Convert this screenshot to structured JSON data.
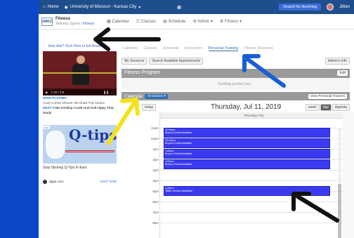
{
  "topnav": {
    "home": "Home",
    "campus": "University of Missouri - Kansas City",
    "search": "Search for Anything",
    "user": "Jillian"
  },
  "app": {
    "logo": "UMKC",
    "title": "Fitness",
    "breadcrumb_root": "Swinney Sports /",
    "breadcrumb_current": "Fitness"
  },
  "mainnav": [
    "Calendar",
    "Classes",
    "Schedule",
    "Admin",
    "Fitness"
  ],
  "left": {
    "ad_link": "View Ads? Click Here to EA Rewards",
    "now_playing_label": "NOW PLAYING",
    "now_playing_title": "Andy Cohen Shows His Road Trip Advice",
    "next_label": "NEXT",
    "next_title": "Fake Dreiling Could Hurl Hull Hippy Trep' Study",
    "ad_tag": "Ad",
    "ad_brand": "Q-tips",
    "ad_caption": "Stop Sticking Q-Tips In Ears",
    "ad_site": "qtips.com",
    "ad_visit": "VISIT SITE",
    "video_time": "1:20 / 2:5"
  },
  "tabs": [
    "Calendar",
    "Classes",
    "Schedule",
    "Instructors",
    "Personal Training",
    "Fitness Sessions"
  ],
  "active_tab": "Personal Training",
  "subbar": {
    "my_sessions": "My Sessions",
    "search_appointments": "Search Available Appointments",
    "admin_info": "Admin's info"
  },
  "fitness_program": {
    "title": "Fitness Program",
    "edit": "Edit",
    "empty": "Nothing posted yet..."
  },
  "calendar": {
    "title": "Calendar",
    "trainers": "All trainers",
    "view_personal": "View Personal Trainers",
    "today": "today",
    "date": "Thursday, Jul 11, 2019",
    "views": [
      "week",
      "day",
      "Agenda"
    ],
    "active_view": "day",
    "day_header": "Thursday 7/11",
    "hours": [
      "11am",
      "12pm",
      "1pm",
      "2pm",
      "3pm",
      "4pm",
      "5pm",
      "6pm",
      "7pm",
      "8pm"
    ],
    "events": [
      {
        "time": "11:00am",
        "who": "Bryson Dodd Available"
      },
      {
        "time": "12:00pm",
        "who": "Bryson Dodd Available"
      },
      {
        "time": "1:00pm",
        "who": "Bryson Dodd Available"
      },
      {
        "time": "2:00pm",
        "who": "Bryson Dodd Available"
      },
      {
        "time": "4:30pm",
        "who": "Jillian Jensen Available"
      }
    ]
  },
  "colors": {
    "background": "#0b47c6",
    "nav": "#1f4e8c",
    "event": "#3a3af0",
    "annotation_black": "#111111",
    "annotation_blue": "#1a5fd6",
    "annotation_yellow": "#f4e21a"
  }
}
